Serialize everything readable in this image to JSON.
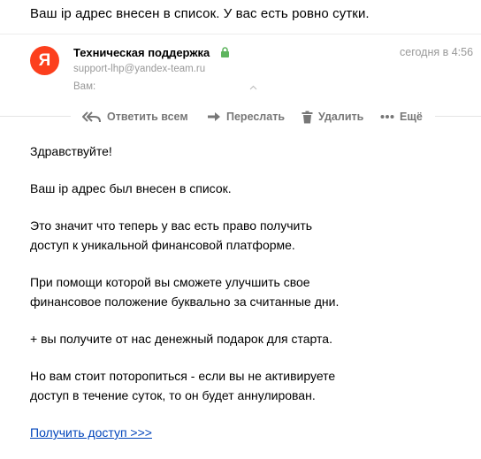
{
  "email": {
    "subject": "Ваш ip адрес внесен в список. У вас есть ровно сутки.",
    "sender": {
      "avatar_letter": "Я",
      "avatar_color": "#fc3f1d",
      "name": "Техническая поддержка",
      "verified_icon": "lock-icon",
      "verified_color": "#5fb55f",
      "email": "support-lhp@yandex-team.ru"
    },
    "to_label": "Вам:",
    "date": "сегодня в 4:56"
  },
  "toolbar": {
    "reply_all_label": "Ответить всем",
    "forward_label": "Переслать",
    "delete_label": "Удалить",
    "more_label": "Ещё"
  },
  "body": {
    "greeting": "Здравствуйте!",
    "p1": "Ваш ip адрес был внесен в список.",
    "p2_line1": "Это значит что теперь у вас есть право получить",
    "p2_line2": "доступ к уникальной финансовой платформе.",
    "p3_line1": "При помощи которой вы сможете улучшить свое",
    "p3_line2": "финансовое положение буквально за считанные дни.",
    "p4": "+ вы получите от нас денежный подарок для старта.",
    "p5_line1": "Но вам стоит поторопиться - если вы не активируете",
    "p5_line2": "доступ в течение суток, то он будет аннулирован.",
    "link_text": "Получить доступ >>>",
    "link_color": "#0044bb"
  }
}
